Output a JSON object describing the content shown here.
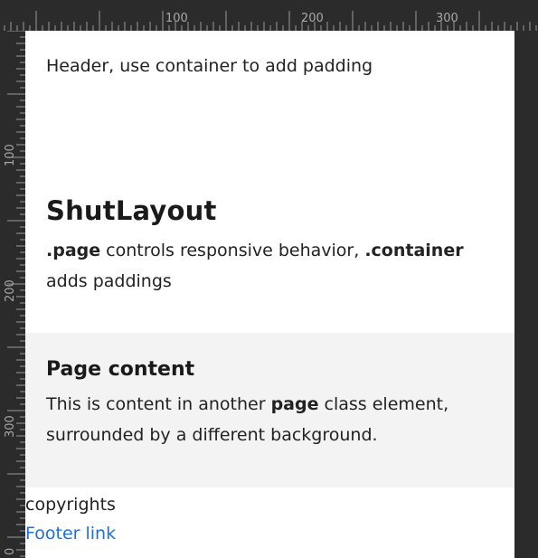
{
  "ruler": {
    "top_labels": [
      "100",
      "200",
      "300"
    ],
    "left_labels": [
      "100",
      "200",
      "300",
      "0"
    ]
  },
  "header": {
    "text": "Header, use container to add padding"
  },
  "hero": {
    "title": "ShutLayout",
    "page_code": ".page",
    "text_mid": " controls responsive behavior, ",
    "container_code": ".container",
    "text_end": " adds paddings"
  },
  "content": {
    "title": "Page content",
    "text_start": "This is content in another ",
    "bold": "page",
    "text_end": " class element, surrounded by a different background."
  },
  "footer": {
    "copyright": "copyrights",
    "link": "Footer link"
  },
  "colors": {
    "ruler_bg": "#2b2b2b",
    "content_bg": "#f3f3f3",
    "link": "#1f6fe0"
  }
}
